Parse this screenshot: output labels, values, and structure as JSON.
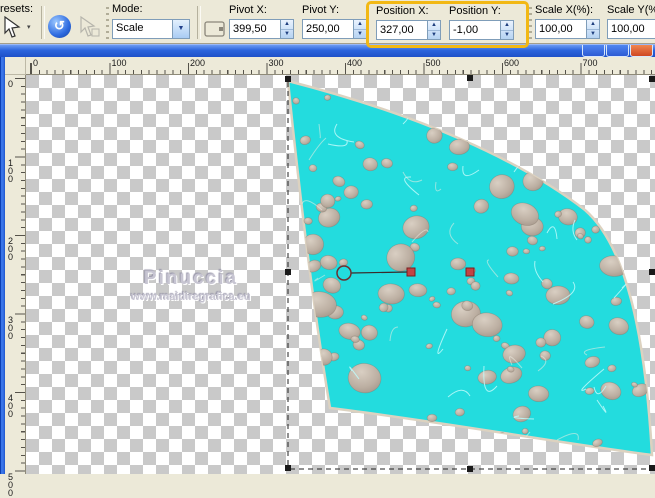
{
  "toolbar": {
    "presets_label": "resets:",
    "mode_label": "Mode:",
    "mode_value": "Scale",
    "pivot_x": {
      "label": "Pivot X:",
      "value": "399,50"
    },
    "pivot_y": {
      "label": "Pivot Y:",
      "value": "250,00"
    },
    "position_x": {
      "label": "Position X:",
      "value": "327,00"
    },
    "position_y": {
      "label": "Position Y:",
      "value": "-1,00"
    },
    "scale_x": {
      "label": "Scale X(%):",
      "value": "100,00"
    },
    "scale_y": {
      "label": "Scale Y(%)",
      "value": "100,00"
    },
    "highlight_color": "#F2B814"
  },
  "rulers": {
    "horizontal_labels": [
      "0",
      "100",
      "200",
      "300",
      "400",
      "500",
      "600",
      "700"
    ],
    "vertical_labels": [
      "0",
      "100",
      "200",
      "300",
      "400",
      "500"
    ]
  },
  "canvas": {
    "watermark_title": "Pinuccia",
    "watermark_url": "www.maidiregrafica.eu",
    "shape_fill": "#23DCDE",
    "shape_edge": "#DCD2C0",
    "circle_fill": "#BCAFA2",
    "marquee_color": "#222222",
    "handle_black": "#1A1A1A",
    "handle_red": "#C24444"
  }
}
